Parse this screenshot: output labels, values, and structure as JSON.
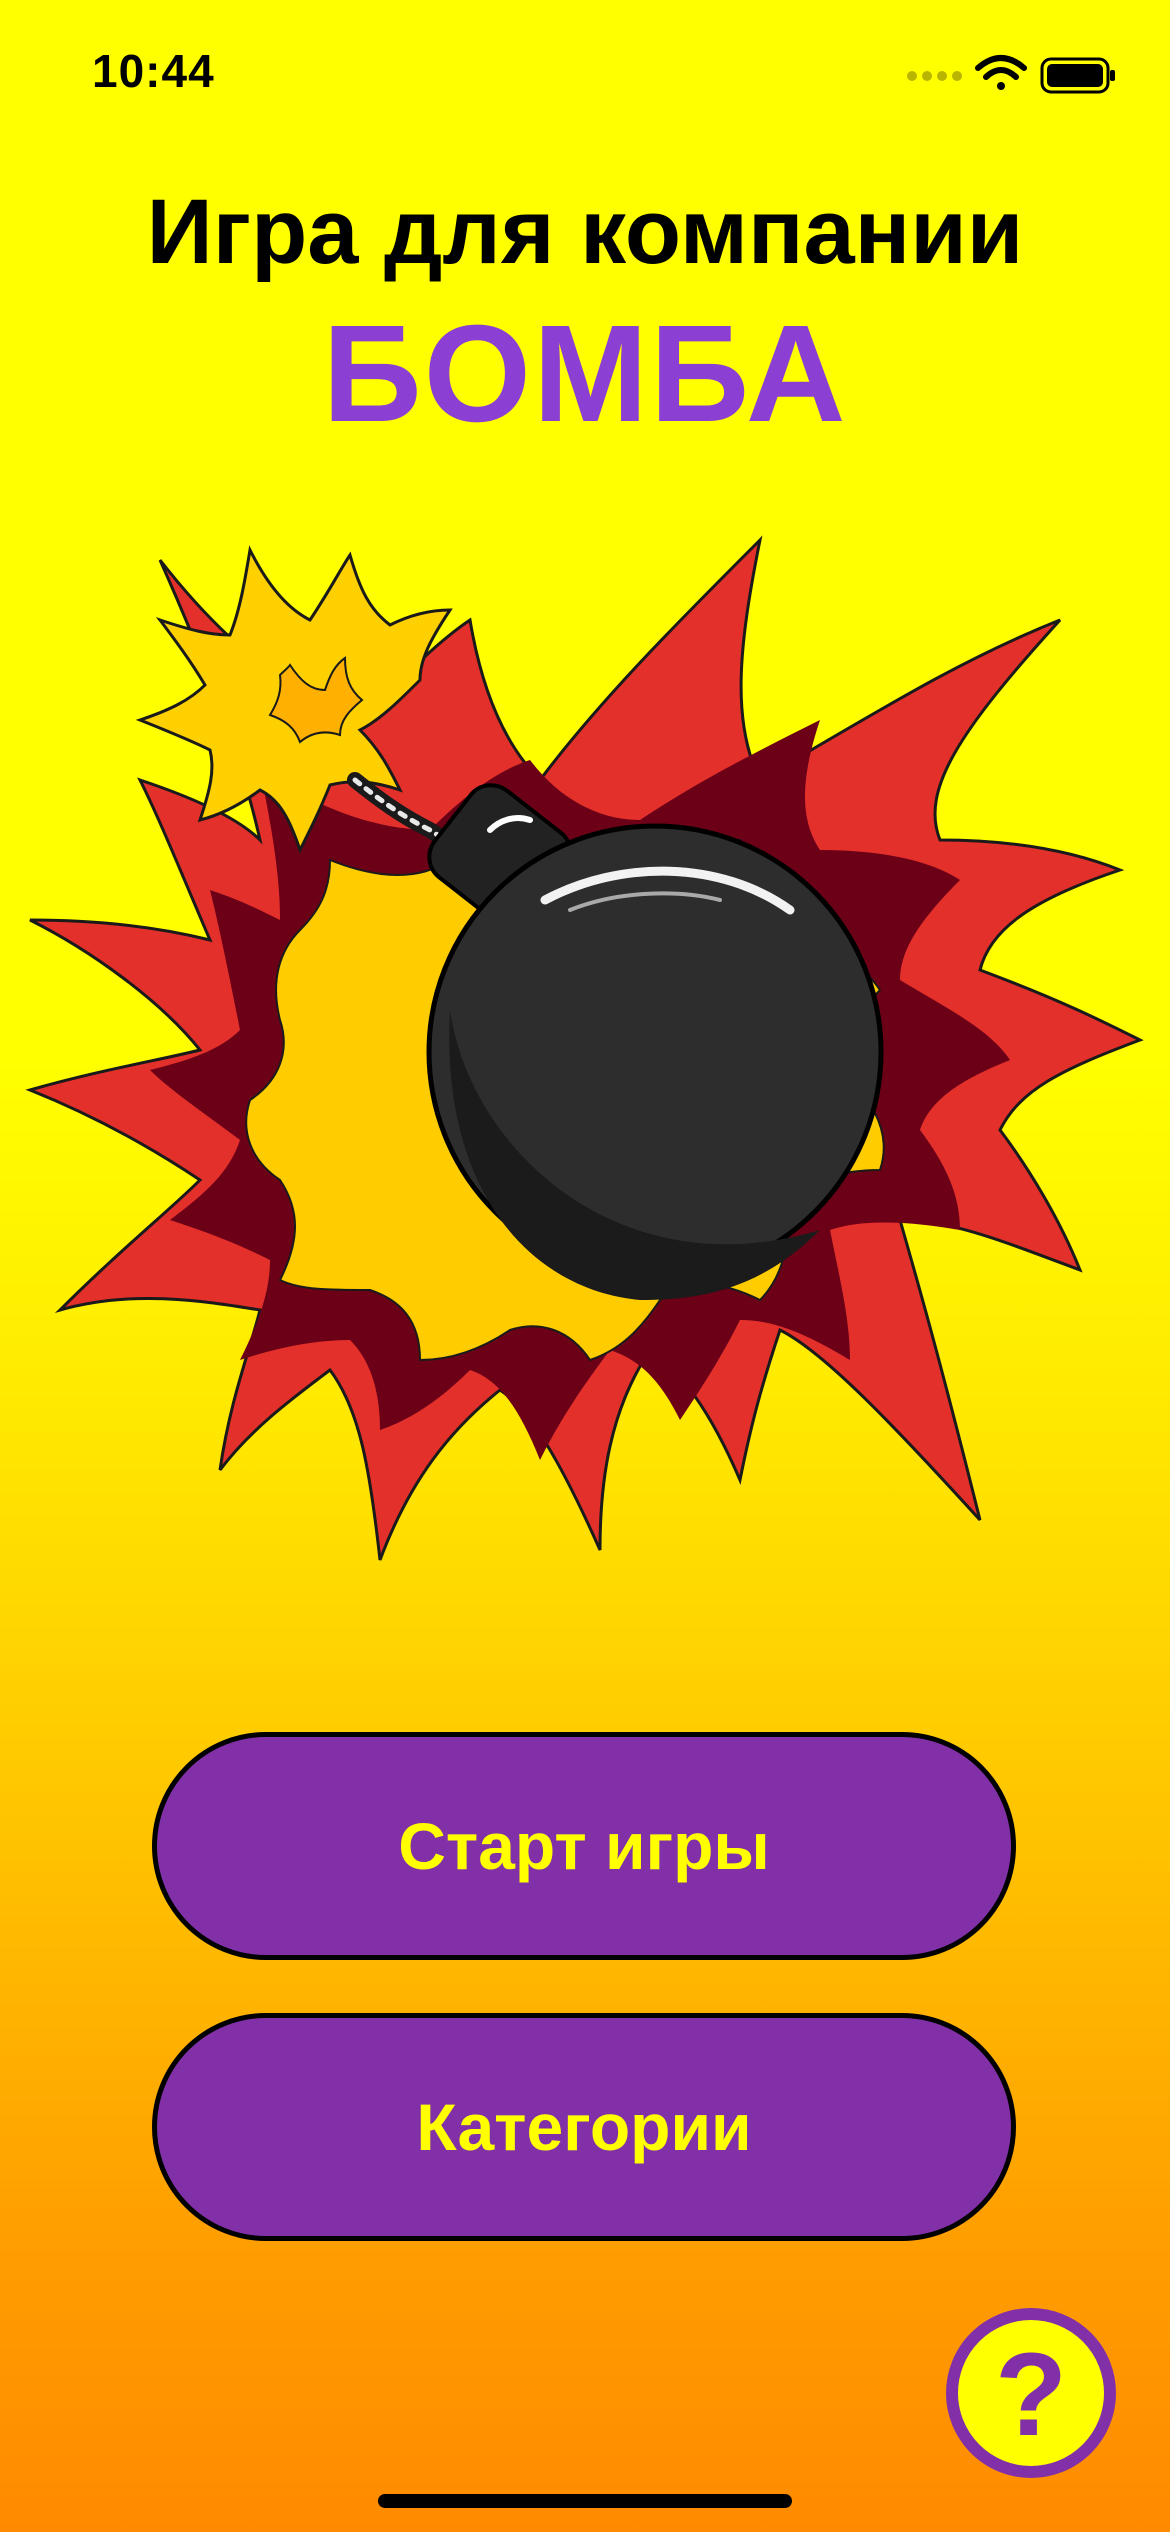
{
  "status_bar": {
    "time": "10:44",
    "icons": [
      "cellular-signal-icon",
      "wifi-icon",
      "battery-icon"
    ]
  },
  "header": {
    "title": "Игра для компании",
    "subtitle": "БОМБА"
  },
  "illustration": {
    "name": "bomb-explosion-illustration"
  },
  "buttons": {
    "start_label": "Старт игры",
    "categories_label": "Категории",
    "help_label": "?"
  },
  "colors": {
    "background_top": "#ffff00",
    "background_bottom": "#ff8a00",
    "accent_purple": "#8230a8",
    "subtitle_purple": "#8b3fd3",
    "button_text": "#ffff00"
  }
}
